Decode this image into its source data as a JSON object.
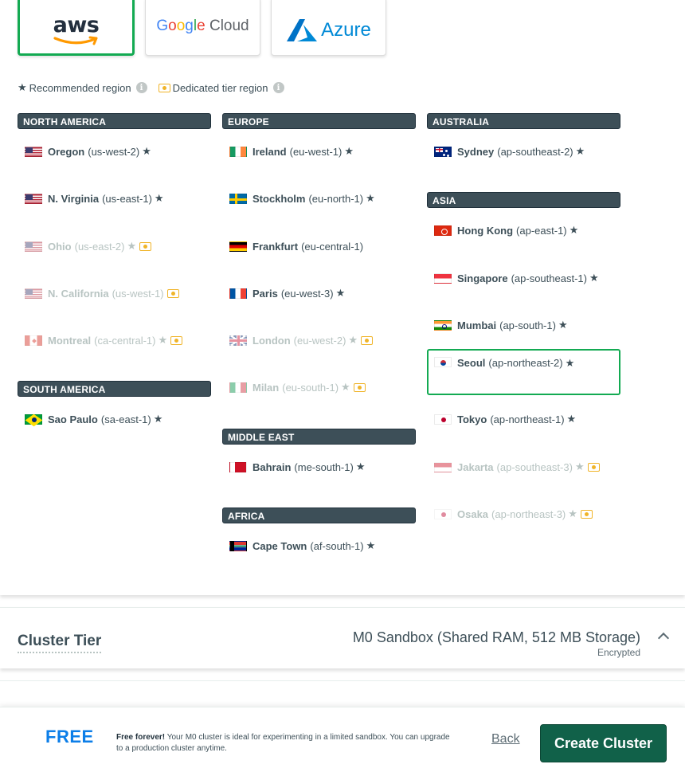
{
  "providers": {
    "aws": "aws",
    "google_a": "Google",
    "google_b": "Cloud",
    "azure": "Azure",
    "selected": "aws"
  },
  "legend": {
    "recommended": "Recommended region",
    "dedicated": "Dedicated tier region"
  },
  "columns": {
    "north_america": {
      "title": "NORTH AMERICA",
      "regions": [
        {
          "name": "Oregon",
          "code": "(us-west-2)",
          "flag": "us-flag-icon",
          "recommended": true,
          "dedicated": false,
          "disabled": false
        },
        {
          "name": "N. Virginia",
          "code": "(us-east-1)",
          "flag": "us-flag-icon",
          "recommended": true,
          "dedicated": false,
          "disabled": false
        },
        {
          "name": "Ohio",
          "code": "(us-east-2)",
          "flag": "us-flag-icon",
          "recommended": true,
          "dedicated": true,
          "disabled": true
        },
        {
          "name": "N. California",
          "code": "(us-west-1)",
          "flag": "us-flag-icon",
          "recommended": false,
          "dedicated": true,
          "disabled": true
        },
        {
          "name": "Montreal",
          "code": "(ca-central-1)",
          "flag": "ca-flag-icon",
          "recommended": true,
          "dedicated": true,
          "disabled": true
        }
      ]
    },
    "south_america": {
      "title": "SOUTH AMERICA",
      "regions": [
        {
          "name": "Sao Paulo",
          "code": "(sa-east-1)",
          "flag": "br-flag-icon",
          "recommended": true,
          "dedicated": false,
          "disabled": false
        }
      ]
    },
    "europe": {
      "title": "EUROPE",
      "regions": [
        {
          "name": "Ireland",
          "code": "(eu-west-1)",
          "flag": "ie-flag-icon",
          "recommended": true,
          "dedicated": false,
          "disabled": false
        },
        {
          "name": "Stockholm",
          "code": "(eu-north-1)",
          "flag": "se-flag-icon",
          "recommended": true,
          "dedicated": false,
          "disabled": false
        },
        {
          "name": "Frankfurt",
          "code": "(eu-central-1)",
          "flag": "de-flag-icon",
          "recommended": false,
          "dedicated": false,
          "disabled": false
        },
        {
          "name": "Paris",
          "code": "(eu-west-3)",
          "flag": "fr-flag-icon",
          "recommended": true,
          "dedicated": false,
          "disabled": false
        },
        {
          "name": "London",
          "code": "(eu-west-2)",
          "flag": "gb-flag-icon",
          "recommended": true,
          "dedicated": true,
          "disabled": true
        },
        {
          "name": "Milan",
          "code": "(eu-south-1)",
          "flag": "it-flag-icon",
          "recommended": true,
          "dedicated": true,
          "disabled": true
        }
      ]
    },
    "middle_east": {
      "title": "MIDDLE EAST",
      "regions": [
        {
          "name": "Bahrain",
          "code": "(me-south-1)",
          "flag": "bh-flag-icon",
          "recommended": true,
          "dedicated": false,
          "disabled": false
        }
      ]
    },
    "africa": {
      "title": "AFRICA",
      "regions": [
        {
          "name": "Cape Town",
          "code": "(af-south-1)",
          "flag": "za-flag-icon",
          "recommended": true,
          "dedicated": false,
          "disabled": false
        }
      ]
    },
    "australia": {
      "title": "AUSTRALIA",
      "regions": [
        {
          "name": "Sydney",
          "code": "(ap-southeast-2)",
          "flag": "au-flag-icon",
          "recommended": true,
          "dedicated": false,
          "disabled": false
        }
      ]
    },
    "asia": {
      "title": "ASIA",
      "regions": [
        {
          "name": "Hong Kong",
          "code": "(ap-east-1)",
          "flag": "hk-flag-icon",
          "recommended": true,
          "dedicated": false,
          "disabled": false
        },
        {
          "name": "Singapore",
          "code": "(ap-southeast-1)",
          "flag": "sg-flag-icon",
          "recommended": true,
          "dedicated": false,
          "disabled": false
        },
        {
          "name": "Mumbai",
          "code": "(ap-south-1)",
          "flag": "in-flag-icon",
          "recommended": true,
          "dedicated": false,
          "disabled": false
        },
        {
          "name": "Seoul",
          "code": "(ap-northeast-2)",
          "flag": "kr-flag-icon",
          "recommended": true,
          "dedicated": false,
          "disabled": false,
          "selected": true
        },
        {
          "name": "Tokyo",
          "code": "(ap-northeast-1)",
          "flag": "jp-flag-icon",
          "recommended": true,
          "dedicated": false,
          "disabled": false
        },
        {
          "name": "Jakarta",
          "code": "(ap-southeast-3)",
          "flag": "id-flag-icon",
          "recommended": true,
          "dedicated": true,
          "disabled": true
        },
        {
          "name": "Osaka",
          "code": "(ap-northeast-3)",
          "flag": "jp-flag-icon",
          "recommended": true,
          "dedicated": true,
          "disabled": true
        }
      ]
    }
  },
  "cluster_tier": {
    "label": "Cluster Tier",
    "value": "M0 Sandbox (Shared RAM, 512 MB Storage)",
    "sub": "Encrypted"
  },
  "footer": {
    "free_label": "FREE",
    "desc_bold": "Free forever!",
    "desc": " Your M0 cluster is ideal for experimenting in a limited sandbox. You can upgrade to a production cluster anytime.",
    "back": "Back",
    "create": "Create Cluster"
  },
  "colors": {
    "accent_green": "#13aa52",
    "button_green": "#116149",
    "header_slate": "#3d4f58",
    "free_blue": "#0c7ee8",
    "dedicated_gold": "#f0b429"
  }
}
